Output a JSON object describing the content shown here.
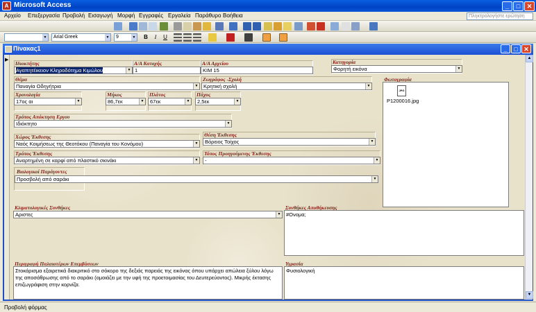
{
  "app": {
    "title": "Microsoft Access",
    "help_placeholder": "Πληκτρολογήστε ερώτηση"
  },
  "menu": [
    "Αρχείο",
    "Επεξεργασία",
    "Προβολή",
    "Εισαγωγή",
    "Μορφή",
    "Εγγραφές",
    "Εργαλεία",
    "Παράθυρο",
    "Βοήθεια"
  ],
  "format_toolbar": {
    "object_combo": "",
    "font_combo": "Arial Greek",
    "size_combo": "9",
    "bold": "B",
    "italic": "I",
    "underline": "U"
  },
  "child_window": {
    "title": "Πίνακας1"
  },
  "form": {
    "owner": {
      "label": "Ιδιοκτήτης",
      "value": "Αγαπητέικειον Κληροδότημα Κιμώλου"
    },
    "acq_no": {
      "label": "Α/Α Κατοχής",
      "value": "1"
    },
    "archive_no": {
      "label": "Α/Α Αρχείου",
      "value": "ΚΙΜ 15"
    },
    "category": {
      "label": "Κατηγορία",
      "value": "Φορητή εικόνα"
    },
    "subject": {
      "label": "Θέμα",
      "value": "Παναγία Οδηγήτρια"
    },
    "painter": {
      "label": "Ζωγράφος -Σχολή",
      "value": "Κρητική σχολή"
    },
    "photo": {
      "label": "Φωτογραφία",
      "file": "P1200016.jpg",
      "icon": "image-file-icon"
    },
    "date": {
      "label": "Χρονολογία",
      "value": "17ος αι"
    },
    "length": {
      "label": "Μήκος",
      "value": "86,7εκ"
    },
    "width": {
      "label": "Πλάτος",
      "value": "67εκ"
    },
    "thickness": {
      "label": "Πάχος",
      "value": "2,5εκ"
    },
    "acq_method": {
      "label": "Τρόπος Απόκτηση Εργου",
      "value": "Ιδιόκτητο"
    },
    "exhibit_space": {
      "label": "Χώρος Έκθεσης",
      "value": "Ναός Κοιμήσεως της Θεοτόκου (Παναγία του Κονόμου)"
    },
    "exhibit_pos": {
      "label": "Θέση Έκθεσης",
      "value": "Βόρειος Τοίχος"
    },
    "exhibit_mode": {
      "label": "Τρόπος Έκθεσης",
      "value": "Αναρτημένη σε καρφί από πλαστικό σκινάκι"
    },
    "prev_place": {
      "label": "Τόπος Προηγούμενης Έκθεσης",
      "value": "-"
    },
    "bio_factors": {
      "label": "Βιολογικοί Παράγοντες",
      "value": "Προσβολή από σαράκι"
    },
    "climate": {
      "label": "Κλιματολογικές Συνθήκες",
      "value": "Αριστες"
    },
    "storage": {
      "label": "Συνθήκες Αποθήκευσης",
      "value": "#Ονομα;"
    },
    "prev_interv": {
      "label": "Περιγραφή Παλαιοτέρων Επεμβάσεων",
      "value": "Στοκάρισμα εξαιρετικά διακριτικό στο σόκορο της δεξιάς παρειάς της εικόνας όπου υπάρχει απώλεια ξύλου λόγω της αποσάθρωσης από το σαράκι (ομοιάζει με την υφή της προετοιμασίας του Δευτερεύοντος). Μικρής έκτασης επιζωγράφιση στην κορνίζα."
    },
    "humidity": {
      "label": "Υγρασία",
      "value": "Φυσιολογική"
    }
  },
  "status": {
    "text": "Προβολή φόρμας"
  },
  "colors": {
    "title_blue": "#0a5fe0",
    "label_red": "#7a1b12",
    "form_bg": "#e9e2cb"
  }
}
